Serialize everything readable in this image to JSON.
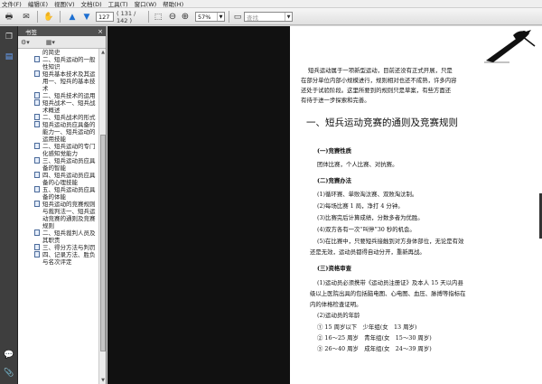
{
  "menu": [
    "文件(F)",
    "编辑(E)",
    "视图(V)",
    "文档(D)",
    "工具(T)",
    "窗口(W)",
    "帮助(H)"
  ],
  "toolbar": {
    "page_current": "127",
    "page_total": "( 131 / 142 )",
    "zoom": "57%",
    "search_placeholder": "查找"
  },
  "panel": {
    "title": "书签",
    "close": "×"
  },
  "bookmarks": [
    "的简史",
    "二、短兵运动的一般性知识",
    "短兵基本技术及其运用一、短兵的基本技术",
    "二、短兵技术的运用",
    "短兵战术一、短兵战术概述",
    "二、短兵战术的形式",
    "短兵运动员应具备的能力一、短兵运动的运用技能",
    "二、短兵运动的专门化感知觉能力",
    "三、短兵运动员应具备的智能",
    "四、短兵运动员应具备的心理技能",
    "五、短兵运动员应具备的体能",
    "短兵运动的竞赛规则与裁判法一、短兵运动竞赛的通则及竞赛规则",
    "二、短兵裁判人员及其职责",
    "三、得分方法与判罚",
    "四、记录方法、胜负与名次评定"
  ],
  "document": {
    "intro": [
      "短兵运动属于一项新型运动，目前还没有正式开展，只是",
      "在部分单位内部小规模进行，规则相对也还不成熟，许多内容",
      "还处于试验阶段。这里所要到的规则只是草案，有些方面还",
      "有待于进一步探索和完善。"
    ],
    "heading": "一、短兵运动竞赛的通则及竞赛规则",
    "s1_title": "(一)竞赛性质",
    "s1_body": "团体比赛，个人比赛、对抗赛。",
    "s2_title": "(二)竞赛办法",
    "s2_items": [
      "(1)循环赛、单败淘汰赛、双败淘汰制。",
      "(2)每场比赛 1 局，净打 4 分钟。",
      "(3)比赛完后计算成绩，分数多者为优胜。",
      "(4)双方各有一次“叫停”30 秒的机会。",
      "(5)在比赛中，只要短兵接触到对方身体部位，无论是有效",
      "还是无效，运动员都得自动分开，重新再战。"
    ],
    "s3_title": "(三)资格审查",
    "s3_items": [
      "(1)运动员必须携带《运动员注册证》及本人 15 天以内县",
      "级以上医院出具的包括脑电图、心电图、血压、脉搏等指标在",
      "内的体格检查证明。",
      "(2)运动员的年龄"
    ],
    "age_groups": [
      "① 15 周岁以下　少年组(女　13 周岁)",
      "② 16～25 周岁　青年组(女　15～30 周岁)",
      "③ 26～40 周岁　成年组(女　24～39 周岁)"
    ]
  }
}
